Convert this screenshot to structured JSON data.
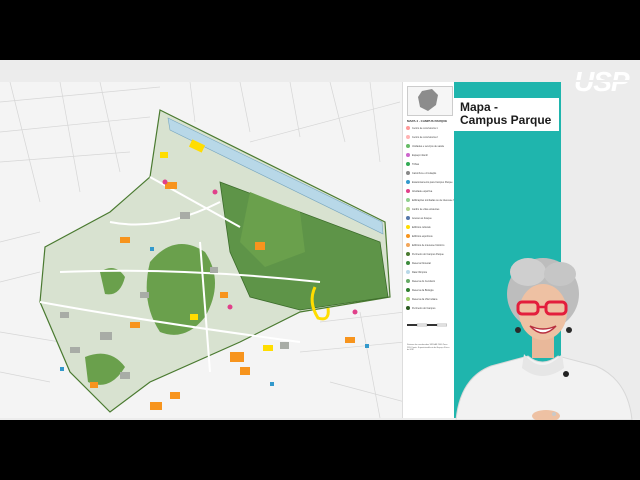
{
  "slide": {
    "title_line1": "Mapa -",
    "title_line2": "Campus Parque",
    "legend_title": "MAPA 4 - CAMPUS PARQUE",
    "legend_items": [
      {
        "label": "Centro de convivência 1",
        "color": "#ff9999"
      },
      {
        "label": "Centro de convivência 2",
        "color": "#ffb3b3"
      },
      {
        "label": "Unidades e serviços de saúde",
        "color": "#66bb66"
      },
      {
        "label": "Espaço infantil",
        "color": "#cc66cc"
      },
      {
        "label": "Trilhas",
        "color": "#33aa55"
      },
      {
        "label": "Caminhos e circulação",
        "color": "#888888"
      },
      {
        "label": "Estacionamento para Campus Parque",
        "color": "#3399cc"
      },
      {
        "label": "Atividade esportiva",
        "color": "#e0408a"
      },
      {
        "label": "Edificações tombadas ou de interesse histórico",
        "color": "#8fcf8f"
      },
      {
        "label": "Jardim de vilas existentes",
        "color": "#b0d48a"
      },
      {
        "label": "Acesso ao bosque",
        "color": "#5577aa"
      },
      {
        "label": "Edifícios culturais",
        "color": "#ffdd00"
      },
      {
        "label": "Edifícios esportivos",
        "color": "#f7941d"
      },
      {
        "label": "Edifícios de interesse histórico",
        "color": "#f2a65a"
      },
      {
        "label": "Perímetro do Campus Parque",
        "color": "#4a7a30"
      },
      {
        "label": "Reserva Florestal",
        "color": "#3d8b3d"
      },
      {
        "label": "Raia Olímpica",
        "color": "#b8d8e8"
      },
      {
        "label": "Reserva do Cemitério",
        "color": "#66aa66"
      },
      {
        "label": "Reserva da Biologia",
        "color": "#2f7f2f"
      },
      {
        "label": "Reserva da Vila Indiana",
        "color": "#99cc66"
      },
      {
        "label": "Perímetro do Campus",
        "color": "#2a5a20"
      }
    ],
    "credits": "Sistema de coordenadas SIRGAS 2000 Zona 23S. Fonte: Superintendência do Espaço Físico da USP."
  },
  "logo": {
    "text": "USP"
  },
  "colors": {
    "teal": "#1fb5ad",
    "park_green": "#4f8a3a",
    "forest_green": "#6aa04c",
    "building_orange": "#f7941d",
    "building_yellow": "#ffdd00",
    "water": "#b8d8e8",
    "campus_fill": "#d8e2d0",
    "presenter_sweater": "#f2f2f2",
    "glasses_red": "#e31e3c"
  }
}
